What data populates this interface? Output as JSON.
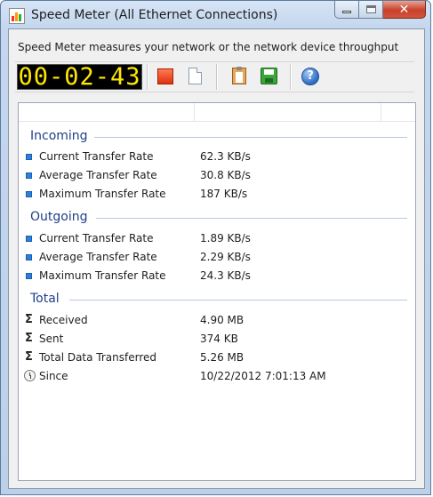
{
  "window": {
    "title": "Speed Meter (All Ethernet Connections)"
  },
  "header": {
    "description": "Speed Meter measures your network or the network device throughput"
  },
  "toolbar": {
    "timer": "00-02-43",
    "buttons": [
      {
        "name": "stop",
        "icon": "stop-icon"
      },
      {
        "name": "new",
        "icon": "new-document-icon"
      },
      {
        "name": "copy",
        "icon": "clipboard-icon"
      },
      {
        "name": "save",
        "icon": "save-icon"
      },
      {
        "name": "help",
        "icon": "help-icon",
        "glyph": "?"
      }
    ]
  },
  "incoming": {
    "heading": "Incoming",
    "rows": [
      {
        "label": "Current Transfer Rate",
        "value": "62.3 KB/s"
      },
      {
        "label": "Average Transfer Rate",
        "value": "30.8 KB/s"
      },
      {
        "label": "Maximum Transfer Rate",
        "value": "187 KB/s"
      }
    ]
  },
  "outgoing": {
    "heading": "Outgoing",
    "rows": [
      {
        "label": "Current Transfer Rate",
        "value": "1.89 KB/s"
      },
      {
        "label": "Average Transfer Rate",
        "value": "2.29 KB/s"
      },
      {
        "label": "Maximum Transfer Rate",
        "value": "24.3 KB/s"
      }
    ]
  },
  "total": {
    "heading": "Total",
    "rows": [
      {
        "label": "Received",
        "value": "4.90 MB",
        "icon": "sigma-icon",
        "glyph": "Σ"
      },
      {
        "label": "Sent",
        "value": "374 KB",
        "icon": "sigma-icon",
        "glyph": "Σ"
      },
      {
        "label": "Total Data Transferred",
        "value": "5.26 MB",
        "icon": "sigma-icon",
        "glyph": "Σ"
      },
      {
        "label": "Since",
        "value": "10/22/2012 7:01:13 AM",
        "icon": "clock-icon"
      }
    ]
  },
  "colors": {
    "accent": "#2f7fd6",
    "group_heading": "#1e3f8a",
    "timer_digits": "#ffe600",
    "close_button": "#c8412b"
  }
}
